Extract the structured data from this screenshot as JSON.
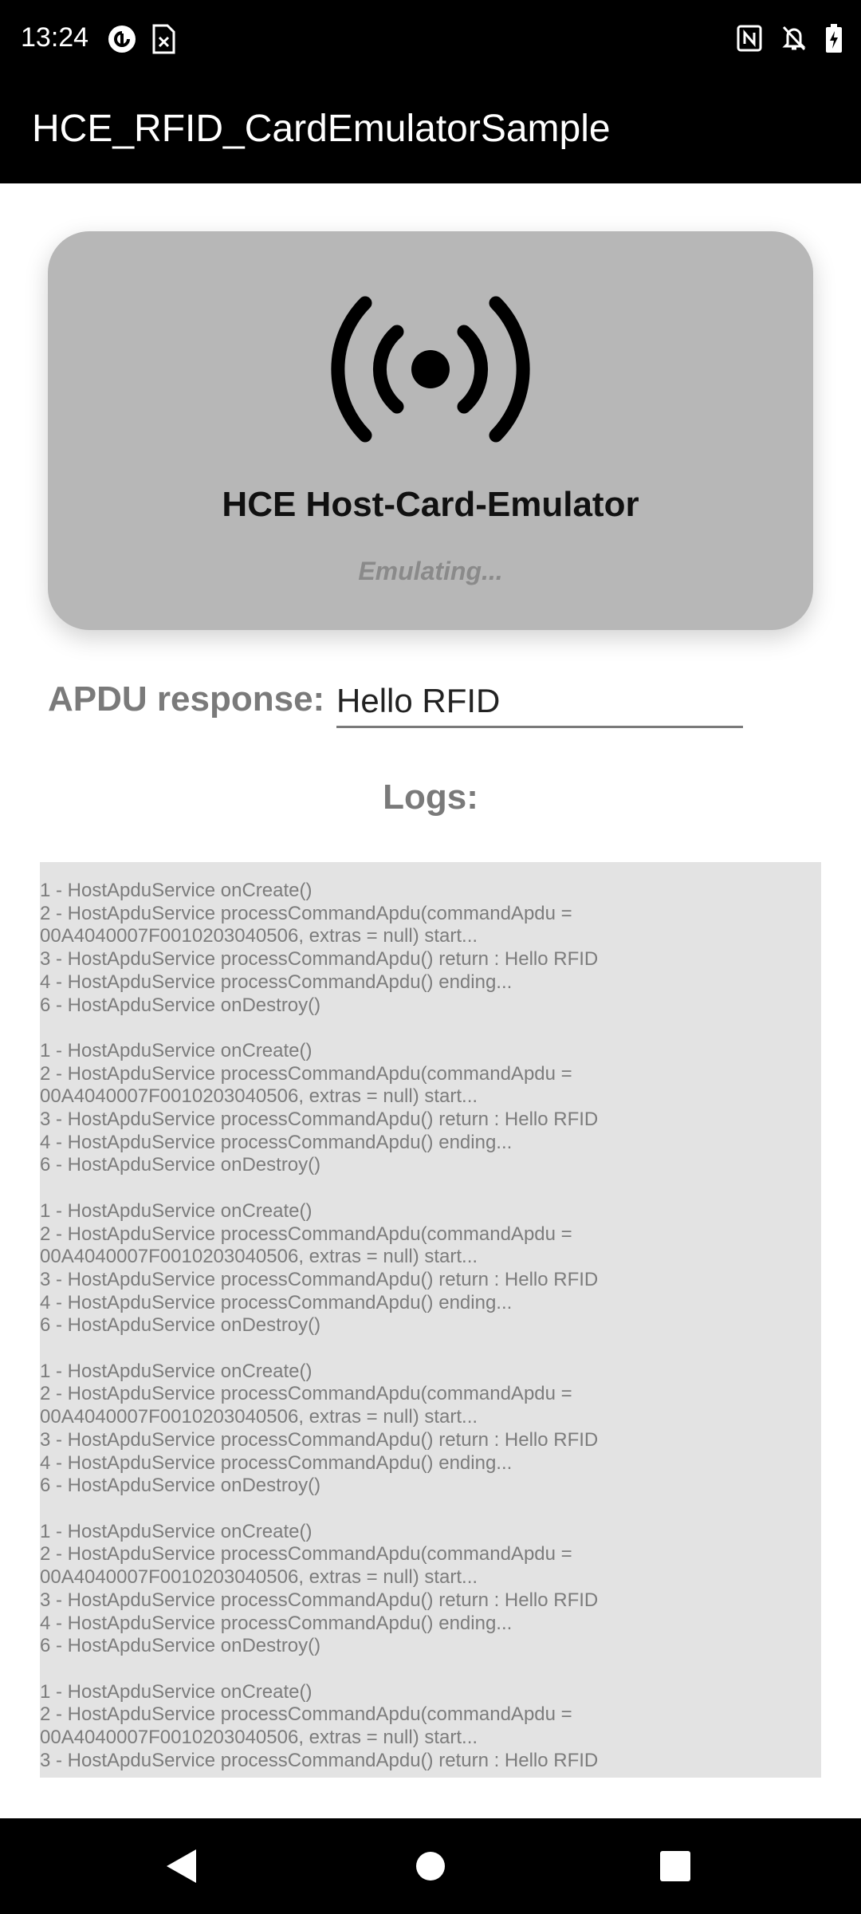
{
  "status_bar": {
    "time": "13:24",
    "left_icons": [
      "pocket-casts-icon",
      "document-close-icon"
    ],
    "right_icons": [
      "nfc-icon",
      "notifications-off-icon",
      "battery-charging-icon"
    ]
  },
  "app_bar": {
    "title": "HCE_RFID_CardEmulatorSample"
  },
  "card": {
    "icon": "broadcast-icon",
    "title": "HCE Host-Card-Emulator",
    "status": "Emulating..."
  },
  "apdu": {
    "label": "APDU response:",
    "value": "Hello RFID"
  },
  "logs": {
    "label": "Logs:",
    "text": "1 - HostApduService onCreate()\n2 - HostApduService processCommandApdu(commandApdu = 00A4040007F0010203040506, extras = null) start...\n3 - HostApduService processCommandApdu() return : Hello RFID\n4 - HostApduService processCommandApdu() ending...\n6 - HostApduService onDestroy()\n\n1 - HostApduService onCreate()\n2 - HostApduService processCommandApdu(commandApdu = 00A4040007F0010203040506, extras = null) start...\n3 - HostApduService processCommandApdu() return : Hello RFID\n4 - HostApduService processCommandApdu() ending...\n6 - HostApduService onDestroy()\n\n1 - HostApduService onCreate()\n2 - HostApduService processCommandApdu(commandApdu = 00A4040007F0010203040506, extras = null) start...\n3 - HostApduService processCommandApdu() return : Hello RFID\n4 - HostApduService processCommandApdu() ending...\n6 - HostApduService onDestroy()\n\n1 - HostApduService onCreate()\n2 - HostApduService processCommandApdu(commandApdu = 00A4040007F0010203040506, extras = null) start...\n3 - HostApduService processCommandApdu() return : Hello RFID\n4 - HostApduService processCommandApdu() ending...\n6 - HostApduService onDestroy()\n\n1 - HostApduService onCreate()\n2 - HostApduService processCommandApdu(commandApdu = 00A4040007F0010203040506, extras = null) start...\n3 - HostApduService processCommandApdu() return : Hello RFID\n4 - HostApduService processCommandApdu() ending...\n6 - HostApduService onDestroy()\n\n1 - HostApduService onCreate()\n2 - HostApduService processCommandApdu(commandApdu = 00A4040007F0010203040506, extras = null) start...\n3 - HostApduService processCommandApdu() return : Hello RFID"
  },
  "nav_bar": {
    "buttons": [
      "back-icon",
      "home-icon",
      "recents-icon"
    ]
  },
  "colors": {
    "status_bar_bg": "#000000",
    "card_bg": "#b7b7b7",
    "logs_bg": "#e3e3e3",
    "label_gray": "#7a7a7a"
  }
}
